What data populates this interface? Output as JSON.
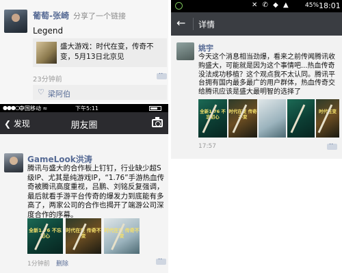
{
  "post_share": {
    "name": "葡萄-张崎",
    "action": "分享了一个链接",
    "text": "Legend",
    "link_title": "盛大游戏：时代在变，传奇不变，5月13日北京见",
    "time": "23分钟前",
    "liker": "梁阿伯",
    "heart_icon": "heart-outline-icon"
  },
  "moments_ios": {
    "statusbar": {
      "signal": "●●●○○",
      "carrier": "中国移动 ≈",
      "time": "下午5:11"
    },
    "back_label": "发现",
    "title": "朋友圈",
    "post": {
      "name": "GameLook洪涛",
      "text": "腾讯与盛大的合作板上钉钉，行业缺少超S级IP、尤其是纯游戏IP，“1.76”手游热血传奇被腾讯高度重视，吕鹏、刘铭反复强调，最后就看手游平台传奇的爆发力到底能有多高了，两家公司的合作也揭开了端游公司深度合作的序幕。",
      "images": [
        {
          "caption": "全新1.76 不忘初心"
        },
        {
          "caption": "时代在变 传奇不变"
        },
        {
          "caption": "时代在变 传奇不变"
        }
      ],
      "time": "1分钟前",
      "delete_label": "删除"
    }
  },
  "detail_android": {
    "statusbar": {
      "icons": "✕ ✆ ◆ ▲",
      "battery": "45%",
      "time": "18:01"
    },
    "title": "详情",
    "post": {
      "name": "姚宇",
      "text": "今天这个消息相当劲爆，看来之前传闻腾讯收购盛大，可能就是因为这个事情吧...热血传奇没法成功移植？这个观点我不太认同。腾讯平台拥有国内最多最广的用户群体，热血传奇交给腾讯应该是盛大最明智的选择了",
      "images": [
        {
          "caption": "全新1.76 不忘初心"
        },
        {
          "caption": "时代在变 传奇不变"
        },
        {
          "caption": ""
        },
        {
          "caption": ""
        },
        {
          "caption": "时代在变"
        }
      ],
      "time": "17:57"
    }
  },
  "colors": {
    "link_blue": "#576b95",
    "ios_nav": "#2b2b2f",
    "android_bar": "#3a3d42"
  }
}
